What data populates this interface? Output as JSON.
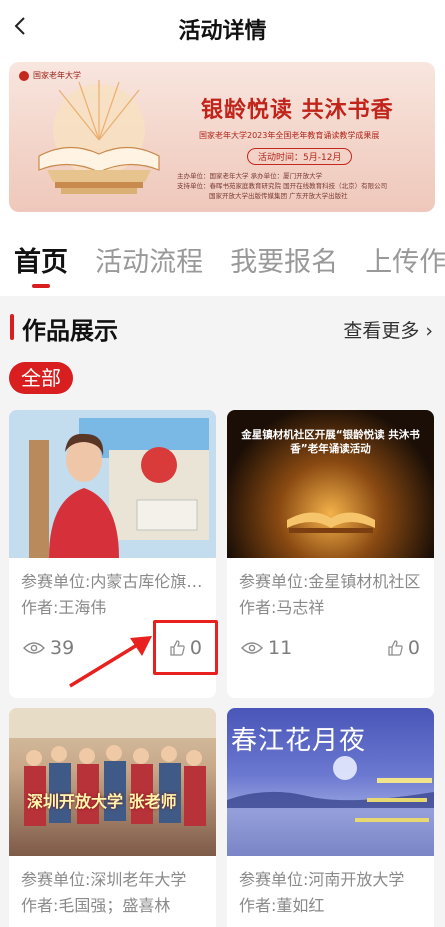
{
  "header": {
    "title": "活动详情"
  },
  "banner": {
    "logo_text": "国家老年大学",
    "title": "银龄悦读 共沐书香",
    "subtitle": "国家老年大学2023年全国老年教育诵读教学成果展",
    "time": "活动时间：5月-12月",
    "org_line1": "主办单位：国家老年大学    承办单位：厦门开放大学",
    "org_line2": "支持单位：春晖书苑家庭教育研究院    国开在线教育科技（北京）有限公司",
    "org_line3": "国家开放大学出版传媒集团    广东开放大学出版社"
  },
  "tabs": [
    "首页",
    "活动流程",
    "我要报名",
    "上传作品"
  ],
  "section": {
    "title": "作品展示",
    "more": "查看更多 ›"
  },
  "filter": {
    "chip": "全部"
  },
  "works": [
    {
      "unit": "参赛单位:内蒙古库伦旗老年大学",
      "author": "作者:王海伟",
      "views": "39",
      "likes": "0",
      "thumb_caption": ""
    },
    {
      "unit": "参赛单位:金星镇材机社区",
      "author": "作者:马志祥",
      "views": "11",
      "likes": "0",
      "thumb_caption": "金星镇材机社区开展“银龄悦读 共沐书香”老年诵读活动"
    },
    {
      "unit": "参赛单位:深圳老年大学",
      "author": "作者:毛国强；盛喜林",
      "views": "",
      "likes": "",
      "thumb_caption": "深圳开放大学 张老师"
    },
    {
      "unit": "参赛单位:河南开放大学",
      "author": "作者:董如红",
      "views": "",
      "likes": "",
      "thumb_caption": "春江花月夜"
    }
  ],
  "colors": {
    "accent": "#d81e1e",
    "text": "#111111",
    "muted": "#8a8a8a"
  }
}
